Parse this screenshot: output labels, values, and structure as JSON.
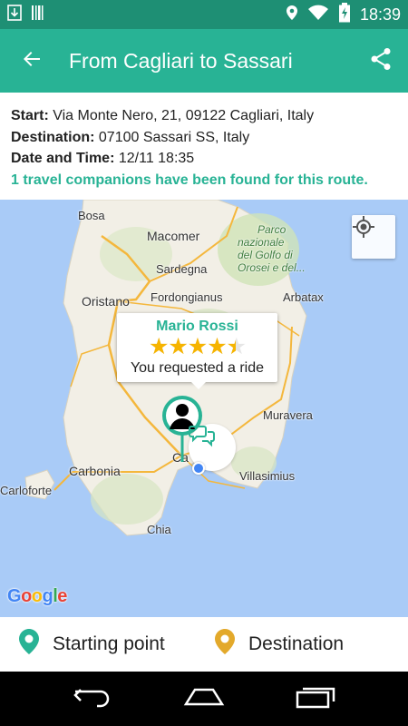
{
  "status_bar": {
    "time": "18:39",
    "icons": [
      "download-icon",
      "barcode-icon",
      "location-icon",
      "wifi-icon",
      "battery-charging-icon"
    ]
  },
  "app_bar": {
    "title": "From Cagliari to Sassari",
    "back_icon": "arrow-back-icon",
    "share_icon": "share-icon"
  },
  "trip_info": {
    "start_label": "Start:",
    "start_value": "Via Monte Nero, 21, 09122 Cagliari, Italy",
    "destination_label": "Destination:",
    "destination_value": "07100 Sassari SS, Italy",
    "datetime_label": "Date and Time:",
    "datetime_value": "12/11 18:35",
    "found_message": "1 travel companions have been found for this route."
  },
  "map": {
    "labels": {
      "bosa": "Bosa",
      "macomer": "Macomer",
      "sardegna": "Sardegna",
      "park_line1": "Parco",
      "park_line2": "nazionale",
      "park_line3": "del Golfo di",
      "park_line4": "Orosei e del...",
      "oristano": "Oristano",
      "fordongianus": "Fordongianus",
      "arbatax": "Arbatax",
      "muravera": "Muravera",
      "cagliari_partial": "Ca",
      "carbonia": "Carbonia",
      "villasimius": "Villasimius",
      "carloforte": "Carloforte",
      "chia": "Chia"
    },
    "google_logo": "Google",
    "locate_icon": "my-location-icon",
    "companion": {
      "name": "Mario Rossi",
      "rating": 4.5,
      "stars": "★★★★★",
      "status": "You requested a ride"
    },
    "colors": {
      "water": "#a9cbf7",
      "land": "#f2efe6",
      "accent": "#28b395"
    }
  },
  "legend": {
    "start_label": "Starting point",
    "destination_label": "Destination",
    "start_color": "#28b395",
    "destination_color": "#e3a92b"
  },
  "nav_bar": {
    "icons": [
      "back-nav-icon",
      "home-nav-icon",
      "recents-nav-icon"
    ]
  }
}
